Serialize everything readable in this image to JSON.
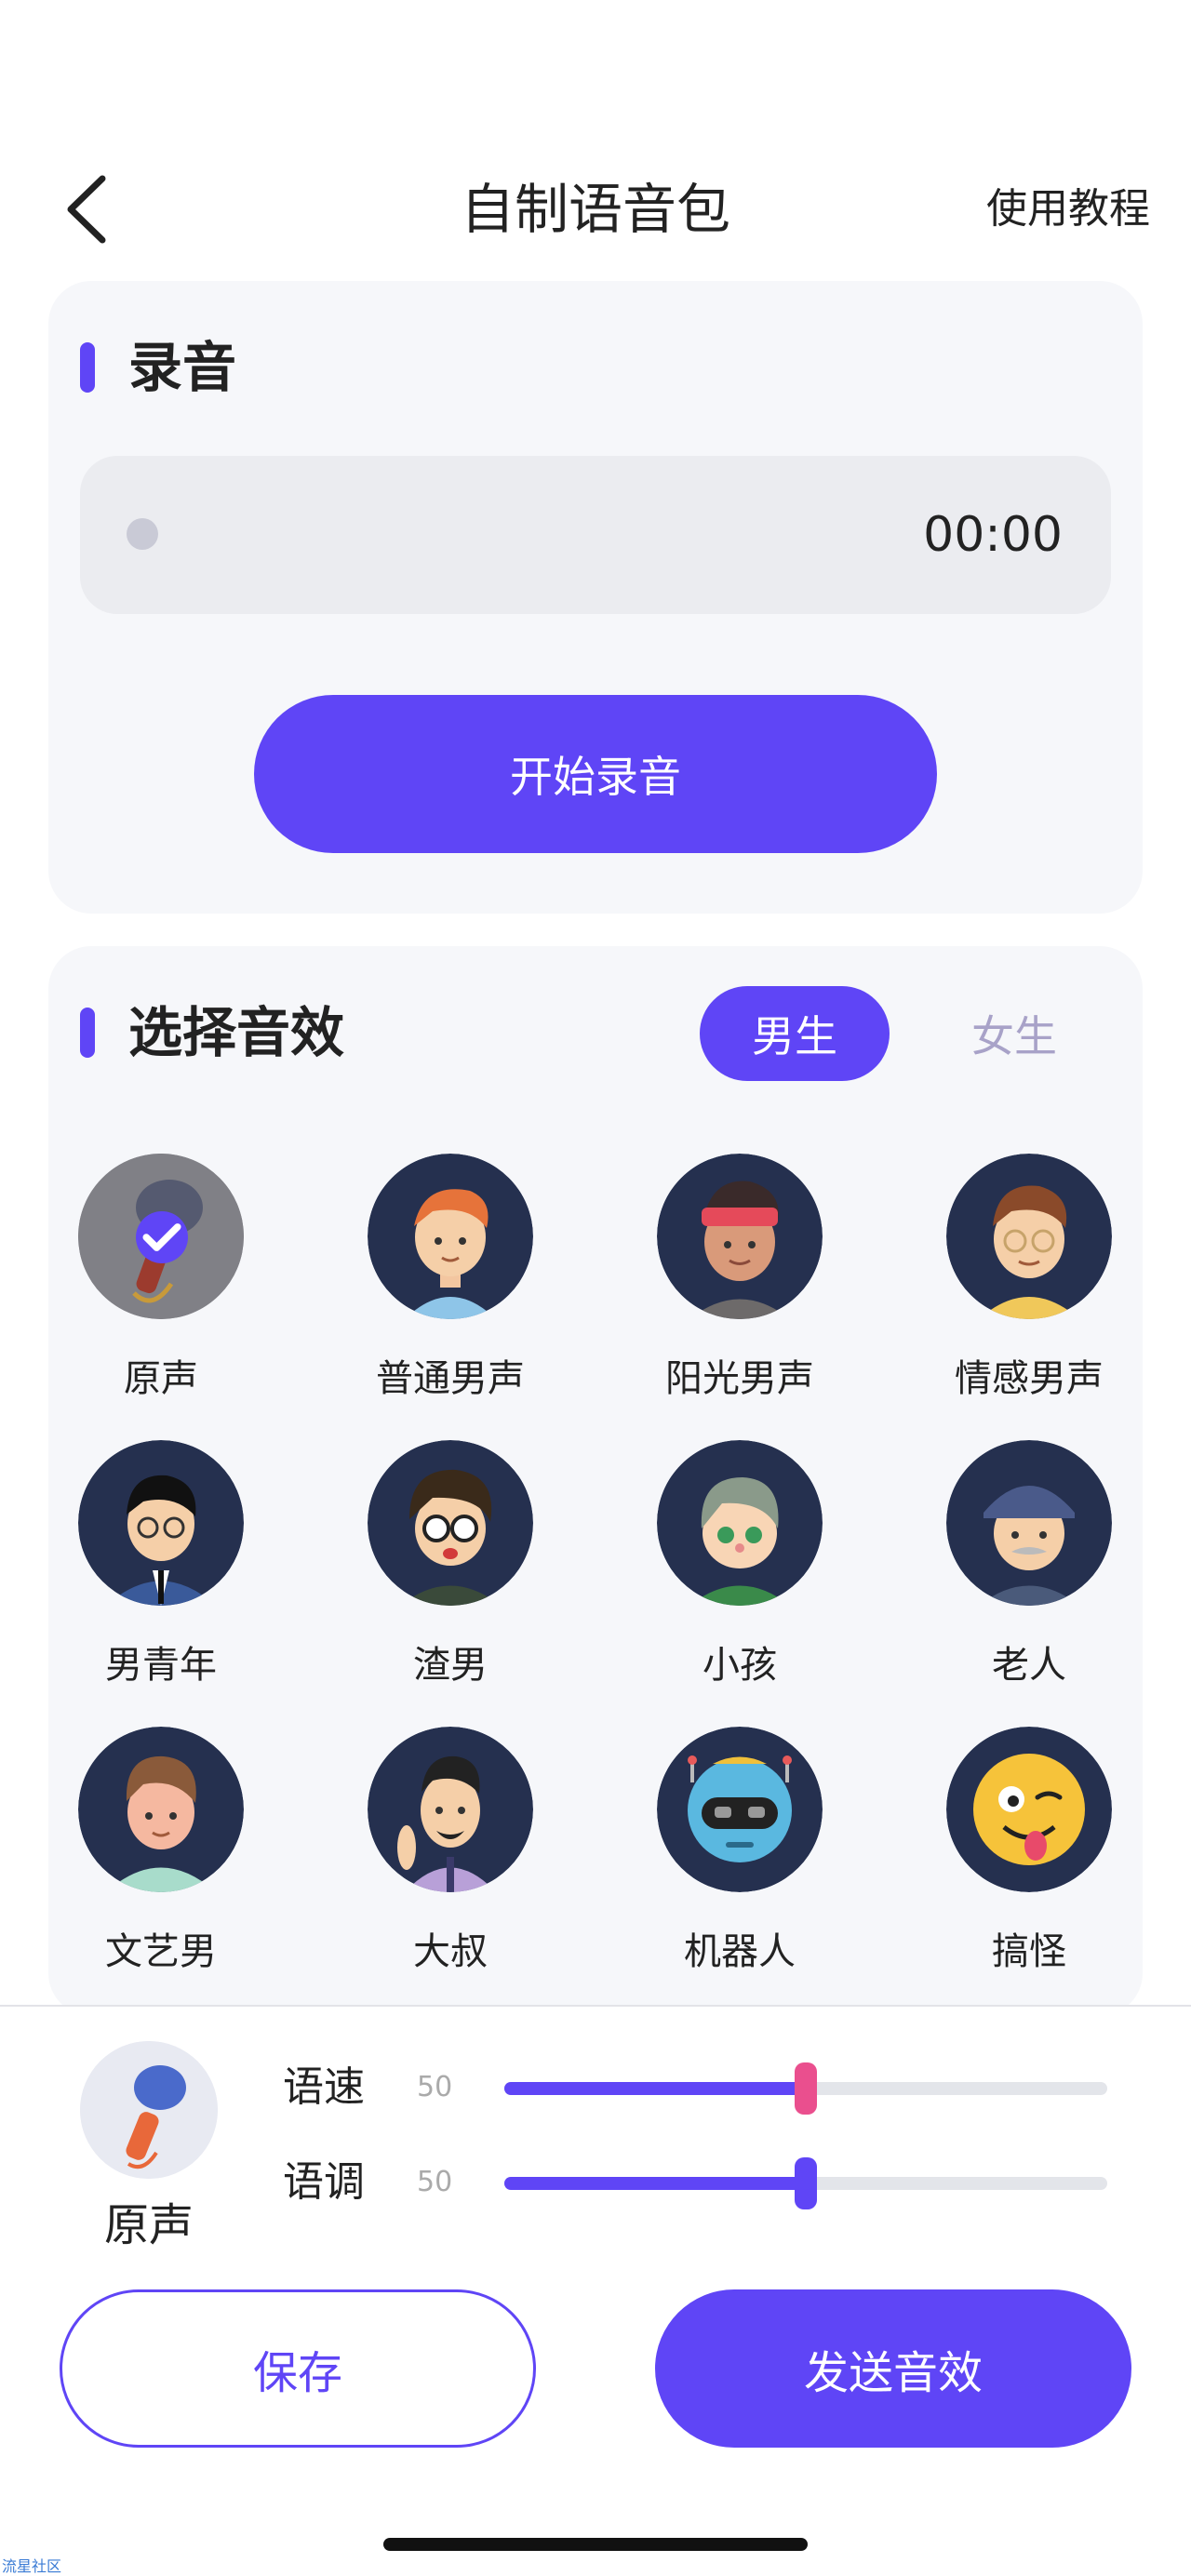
{
  "header": {
    "title": "自制语音包",
    "tutorial_label": "使用教程"
  },
  "record": {
    "section_title": "录音",
    "timer": "00:00",
    "start_label": "开始录音"
  },
  "effects": {
    "section_title": "选择音效",
    "gender_tabs": [
      {
        "label": "男生",
        "selected": true
      },
      {
        "label": "女生",
        "selected": false
      }
    ],
    "items": [
      {
        "label": "原声",
        "icon": "microphone-avatar",
        "selected": true
      },
      {
        "label": "普通男声",
        "icon": "ordinary-man-avatar"
      },
      {
        "label": "阳光男声",
        "icon": "sunny-boy-avatar"
      },
      {
        "label": "情感男声",
        "icon": "emotional-man-avatar"
      },
      {
        "label": "男青年",
        "icon": "young-man-avatar"
      },
      {
        "label": "渣男",
        "icon": "playboy-avatar"
      },
      {
        "label": "小孩",
        "icon": "child-avatar"
      },
      {
        "label": "老人",
        "icon": "old-man-avatar"
      },
      {
        "label": "文艺男",
        "icon": "artsy-man-avatar"
      },
      {
        "label": "大叔",
        "icon": "uncle-avatar"
      },
      {
        "label": "机器人",
        "icon": "robot-avatar"
      },
      {
        "label": "搞怪",
        "icon": "funny-emoji-avatar"
      }
    ]
  },
  "bottom": {
    "selected_name": "原声",
    "speed": {
      "label": "语速",
      "value": "50",
      "fraction": 0.5
    },
    "pitch": {
      "label": "语调",
      "value": "50",
      "fraction": 0.5
    },
    "save_label": "保存",
    "send_label": "发送音效"
  },
  "watermark": "流星社区",
  "colors": {
    "accent": "#5f45f6",
    "thumb_pink": "#ea4f8e",
    "avatar_bg": "#25304f"
  }
}
